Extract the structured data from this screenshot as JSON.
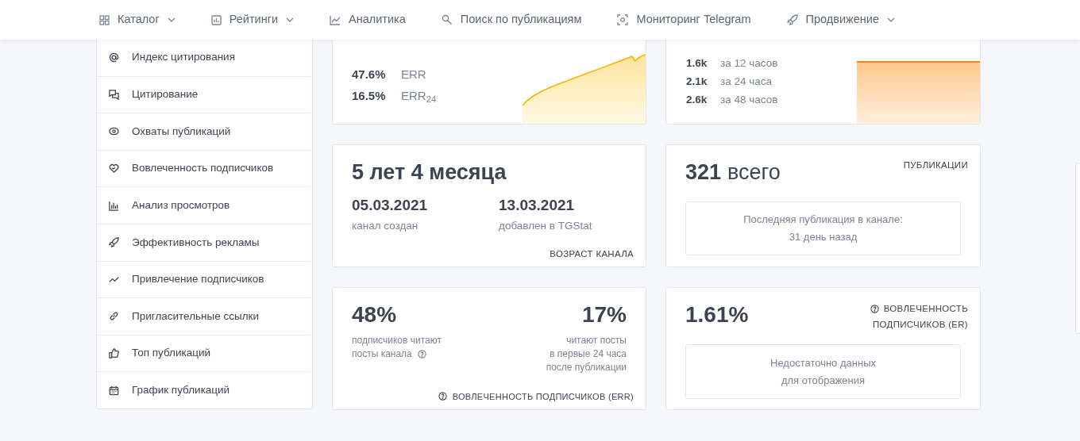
{
  "nav": [
    {
      "label": "Каталог",
      "dropdown": true
    },
    {
      "label": "Рейтинги",
      "dropdown": true
    },
    {
      "label": "Аналитика",
      "dropdown": false
    },
    {
      "label": "Поиск по публикациям",
      "dropdown": false
    },
    {
      "label": "Мониторинг Telegram",
      "dropdown": false
    },
    {
      "label": "Продвижение",
      "dropdown": true
    }
  ],
  "sidebar": {
    "items": [
      {
        "label": "Индекс цитирования"
      },
      {
        "label": "Цитирование"
      },
      {
        "label": "Охваты публикаций"
      },
      {
        "label": "Вовлеченность подписчиков"
      },
      {
        "label": "Анализ просмотров"
      },
      {
        "label": "Эффективность рекламы"
      },
      {
        "label": "Привлечение подписчиков"
      },
      {
        "label": "Пригласительные ссылки"
      },
      {
        "label": "Топ публикаций"
      },
      {
        "label": "График публикаций"
      }
    ]
  },
  "err_card": {
    "rows": [
      {
        "value": "47.6%",
        "label": "ERR"
      },
      {
        "value": "16.5%",
        "label": "ERR$_{24}$"
      }
    ]
  },
  "views_card": {
    "rows": [
      {
        "value": "1.6k",
        "label": "за 12 часов"
      },
      {
        "value": "2.1k",
        "label": "за 24 часа"
      },
      {
        "value": "2.6k",
        "label": "за 48 часов"
      }
    ]
  },
  "age_card": {
    "title": "5 лет 4 месяца",
    "dates": [
      {
        "value": "05.03.2021",
        "label": "канал создан"
      },
      {
        "value": "13.03.2021",
        "label": "добавлен в TGStat"
      }
    ],
    "caption": "ВОЗРАСТ КАНАЛА"
  },
  "posts_card": {
    "count": "321",
    "unit": "всего",
    "caption": "ПУБЛИКАЦИИ",
    "note_lines": [
      "Последняя публикация в канале:",
      "31 день назад"
    ]
  },
  "reach_card": {
    "stats": [
      {
        "value": "48%",
        "lines": [
          "подписчиков читают",
          "посты канала"
        ],
        "help": true
      },
      {
        "value": "17%",
        "lines": [
          "читают посты",
          "в первые 24 часа",
          "после публикации"
        ],
        "help": false
      }
    ],
    "caption": "ВОВЛЕЧЕННОСТЬ ПОДПИСЧИКОВ (ERR)"
  },
  "er_card": {
    "value": "1.61%",
    "caption_lines": [
      "ВОВЛЕЧЕННОСТЬ",
      "ПОДПИСЧИКОВ (ER)"
    ],
    "note_lines": [
      "Недостаточно данных",
      "для отображения"
    ]
  }
}
